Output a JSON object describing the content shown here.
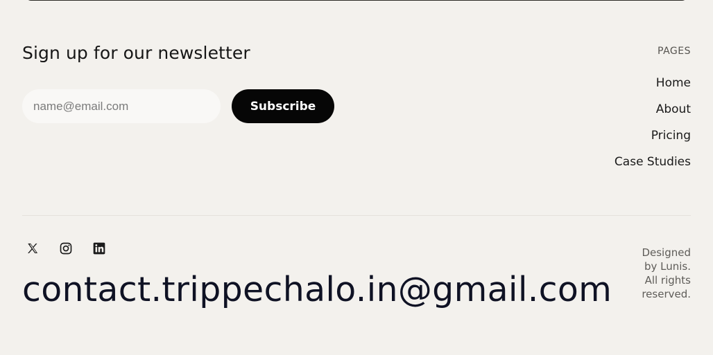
{
  "newsletter": {
    "title": "Sign up for our newsletter",
    "email_placeholder": "name@email.com",
    "subscribe_label": "Subscribe"
  },
  "pages": {
    "heading": "PAGES",
    "links": [
      "Home",
      "About",
      "Pricing",
      "Case Studies"
    ]
  },
  "social": {
    "icons": [
      "x-icon",
      "instagram-icon",
      "linkedin-icon"
    ]
  },
  "contact": {
    "email": "contact.trippechalo.in@gmail.com"
  },
  "credits": {
    "text": "Designed by Lunis. All rights reserved."
  },
  "colors": {
    "background": "#f3f1ed",
    "button": "#060606",
    "button_text": "#ffffff",
    "input_background": "#f9f8f6"
  }
}
